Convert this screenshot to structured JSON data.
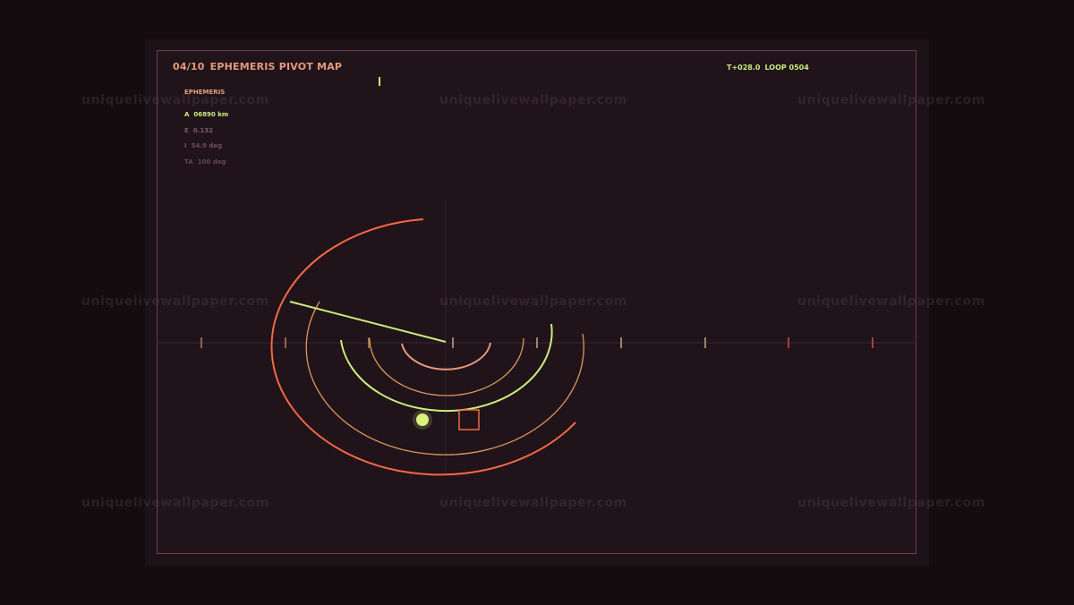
{
  "header": {
    "index": "04/10",
    "title": "EPHEMERIS PIVOT MAP",
    "clock": "T+028.0",
    "loop": "LOOP 0504"
  },
  "readout": {
    "heading": "EPHEMERIS",
    "rows": [
      {
        "key": "A",
        "value": "06890 km"
      },
      {
        "key": "E",
        "value": "0.132"
      },
      {
        "key": "I",
        "value": "54.9 deg"
      },
      {
        "key": "TA",
        "value": "100 deg"
      }
    ]
  },
  "watermark": "uniquelivewallpaper.com",
  "colors": {
    "background": "#150c10",
    "panel": "#21131a",
    "frame": "#6a4049",
    "accent_orange": "#f26a43",
    "accent_lime": "#c9ee7d",
    "accent_peach": "#e39a7c",
    "accent_amber": "#d99a5a"
  },
  "icons": {
    "orbit-body": "filled-circle",
    "target-marker": "square-outline"
  }
}
